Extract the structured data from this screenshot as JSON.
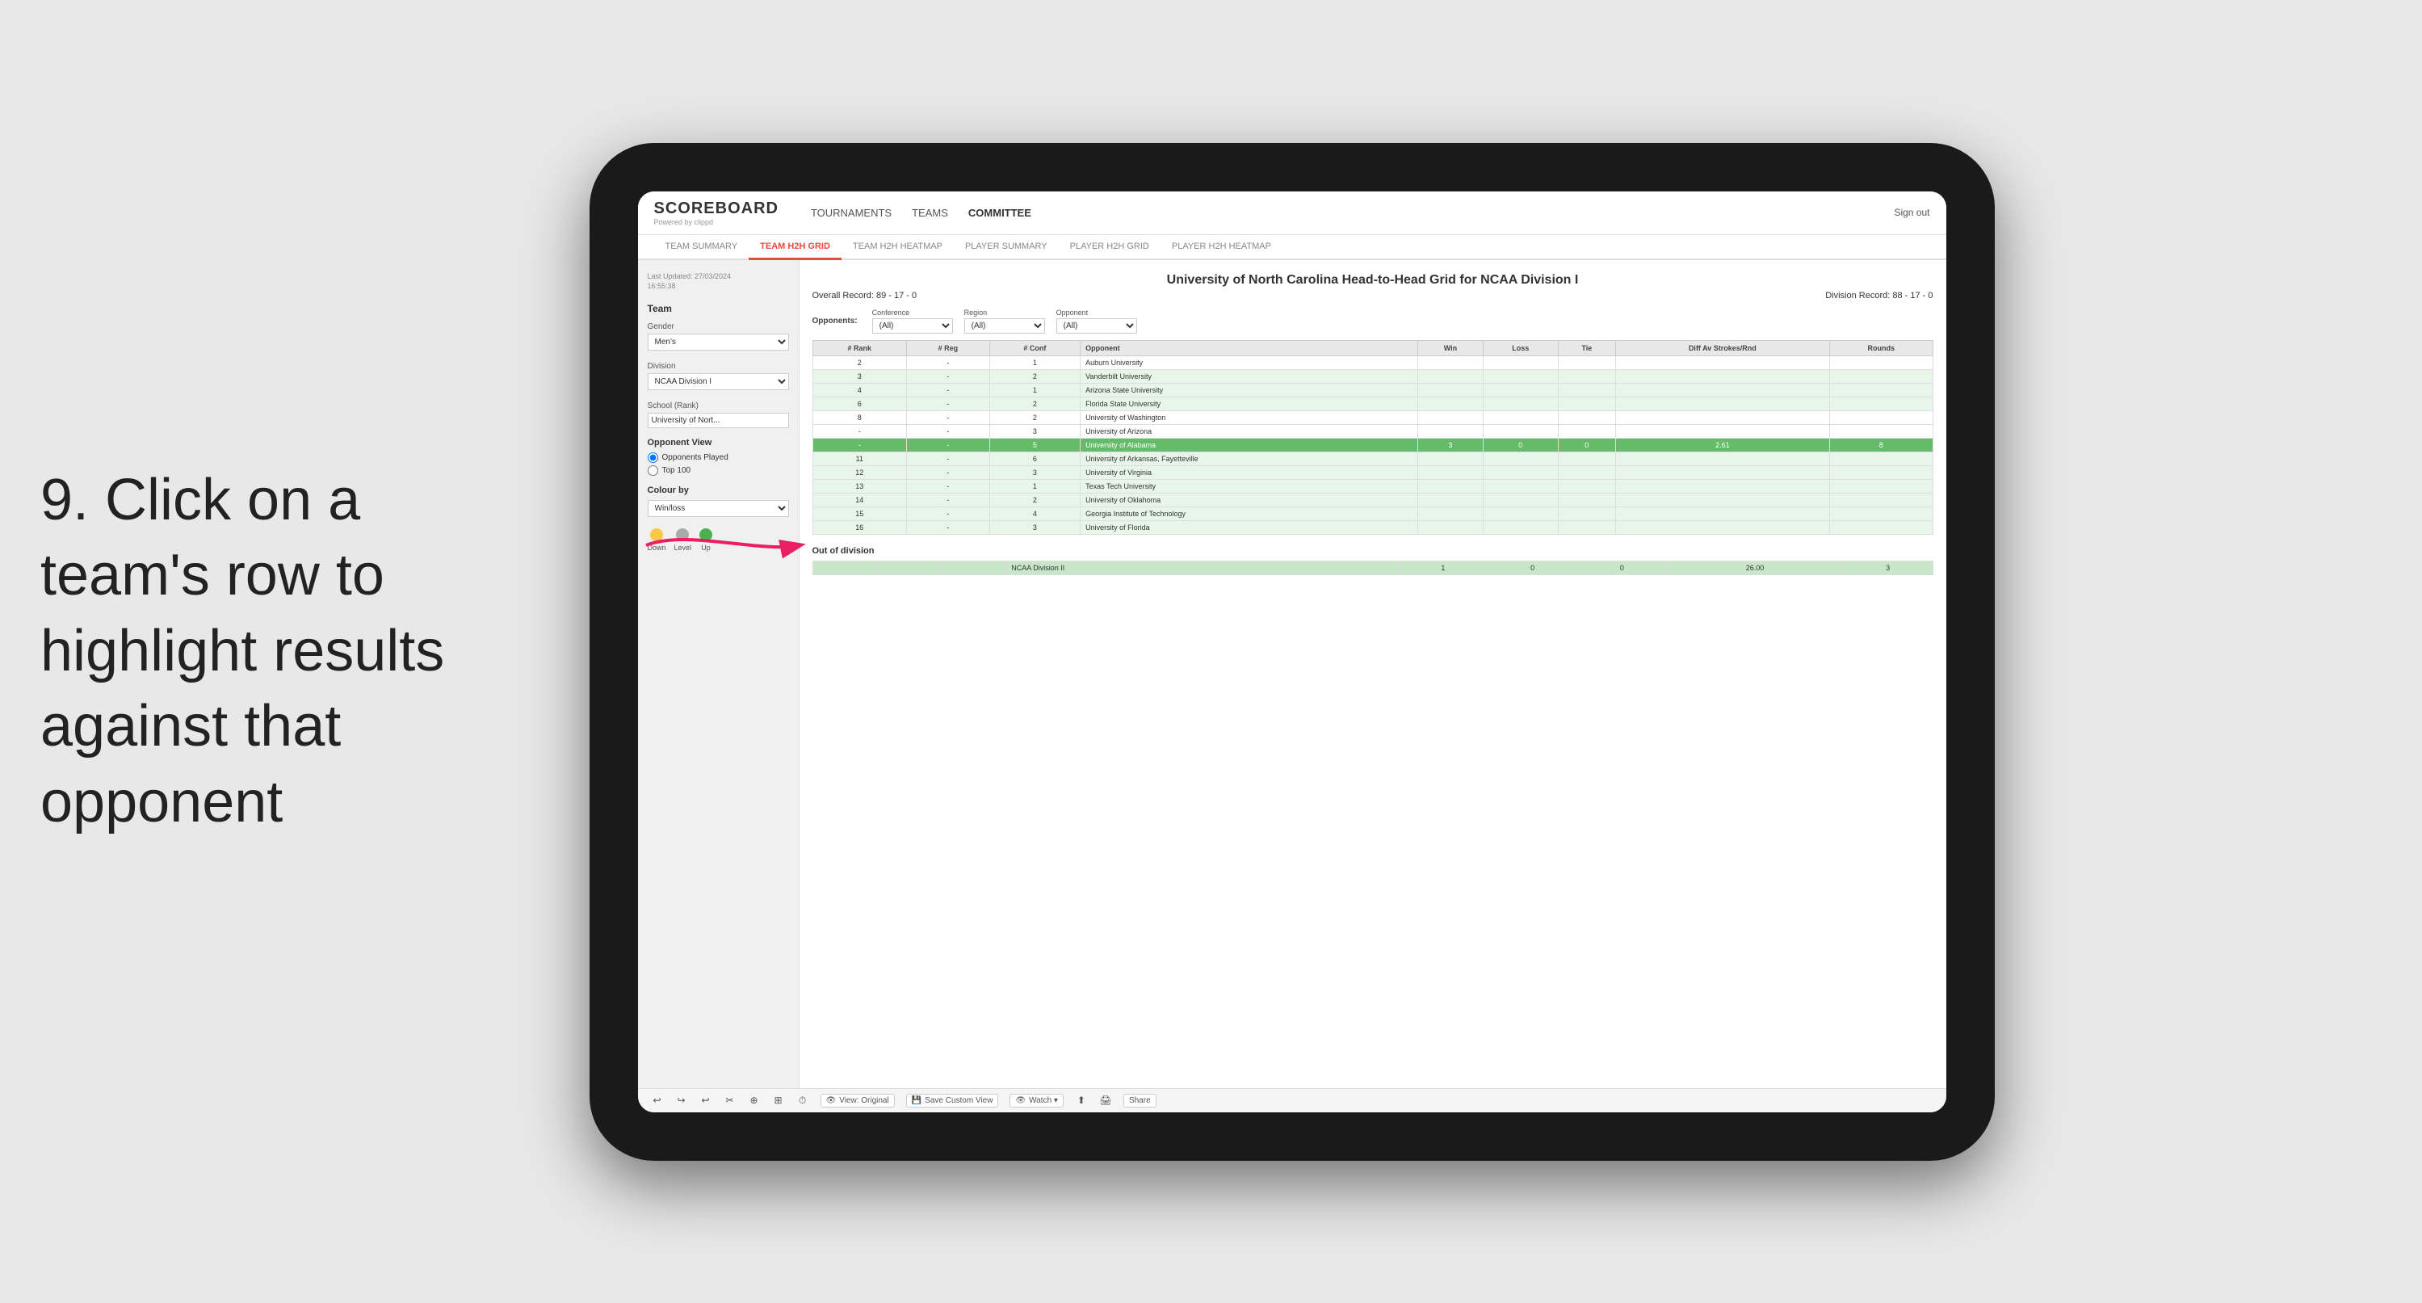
{
  "instruction": {
    "text": "9. Click on a team's row to highlight results against that opponent"
  },
  "nav": {
    "logo": "SCOREBOARD",
    "logo_sub": "Powered by clippd",
    "items": [
      "TOURNAMENTS",
      "TEAMS",
      "COMMITTEE"
    ],
    "sign_out": "Sign out"
  },
  "sub_nav": {
    "items": [
      "TEAM SUMMARY",
      "TEAM H2H GRID",
      "TEAM H2H HEATMAP",
      "PLAYER SUMMARY",
      "PLAYER H2H GRID",
      "PLAYER H2H HEATMAP"
    ],
    "active": "TEAM H2H GRID"
  },
  "sidebar": {
    "last_updated_label": "Last Updated: 27/03/2024",
    "last_updated_time": "16:55:38",
    "team_label": "Team",
    "gender_label": "Gender",
    "gender_value": "Men's",
    "division_label": "Division",
    "division_value": "NCAA Division I",
    "school_label": "School (Rank)",
    "school_value": "University of Nort...",
    "opponent_view_label": "Opponent View",
    "opponents_played": "Opponents Played",
    "top_100": "Top 100",
    "colour_by_label": "Colour by",
    "colour_by_value": "Win/loss",
    "legend_down": "Down",
    "legend_level": "Level",
    "legend_up": "Up"
  },
  "grid": {
    "title": "University of North Carolina Head-to-Head Grid for NCAA Division I",
    "overall_record": "Overall Record: 89 - 17 - 0",
    "division_record": "Division Record: 88 - 17 - 0",
    "filters": {
      "opponents_label": "Opponents:",
      "conference_label": "Conference",
      "conference_value": "(All)",
      "region_label": "Region",
      "region_value": "(All)",
      "opponent_label": "Opponent",
      "opponent_value": "(All)"
    },
    "columns": [
      "# Rank",
      "# Reg",
      "# Conf",
      "Opponent",
      "Win",
      "Loss",
      "Tie",
      "Diff Av Strokes/Rnd",
      "Rounds"
    ],
    "rows": [
      {
        "rank": "2",
        "reg": "-",
        "conf": "1",
        "opponent": "Auburn University",
        "win": "",
        "loss": "",
        "tie": "",
        "diff": "",
        "rounds": "",
        "row_class": "row-normal"
      },
      {
        "rank": "3",
        "reg": "-",
        "conf": "2",
        "opponent": "Vanderbilt University",
        "win": "",
        "loss": "",
        "tie": "",
        "diff": "",
        "rounds": "",
        "row_class": "row-light-green"
      },
      {
        "rank": "4",
        "reg": "-",
        "conf": "1",
        "opponent": "Arizona State University",
        "win": "",
        "loss": "",
        "tie": "",
        "diff": "",
        "rounds": "",
        "row_class": "row-light-green"
      },
      {
        "rank": "6",
        "reg": "-",
        "conf": "2",
        "opponent": "Florida State University",
        "win": "",
        "loss": "",
        "tie": "",
        "diff": "",
        "rounds": "",
        "row_class": "row-light-green"
      },
      {
        "rank": "8",
        "reg": "-",
        "conf": "2",
        "opponent": "University of Washington",
        "win": "",
        "loss": "",
        "tie": "",
        "diff": "",
        "rounds": "",
        "row_class": "row-normal"
      },
      {
        "rank": "-",
        "reg": "-",
        "conf": "3",
        "opponent": "University of Arizona",
        "win": "",
        "loss": "",
        "tie": "",
        "diff": "",
        "rounds": "",
        "row_class": "row-normal"
      },
      {
        "rank": "-",
        "reg": "-",
        "conf": "5",
        "opponent": "University of Alabama",
        "win": "3",
        "loss": "0",
        "tie": "0",
        "diff": "2.61",
        "rounds": "8",
        "row_class": "row-highlighted"
      },
      {
        "rank": "11",
        "reg": "-",
        "conf": "6",
        "opponent": "University of Arkansas, Fayetteville",
        "win": "",
        "loss": "",
        "tie": "",
        "diff": "",
        "rounds": "",
        "row_class": "row-light-green"
      },
      {
        "rank": "12",
        "reg": "-",
        "conf": "3",
        "opponent": "University of Virginia",
        "win": "",
        "loss": "",
        "tie": "",
        "diff": "",
        "rounds": "",
        "row_class": "row-light-green"
      },
      {
        "rank": "13",
        "reg": "-",
        "conf": "1",
        "opponent": "Texas Tech University",
        "win": "",
        "loss": "",
        "tie": "",
        "diff": "",
        "rounds": "",
        "row_class": "row-light-green"
      },
      {
        "rank": "14",
        "reg": "-",
        "conf": "2",
        "opponent": "University of Oklahoma",
        "win": "",
        "loss": "",
        "tie": "",
        "diff": "",
        "rounds": "",
        "row_class": "row-light-green"
      },
      {
        "rank": "15",
        "reg": "-",
        "conf": "4",
        "opponent": "Georgia Institute of Technology",
        "win": "",
        "loss": "",
        "tie": "",
        "diff": "",
        "rounds": "",
        "row_class": "row-light-green"
      },
      {
        "rank": "16",
        "reg": "-",
        "conf": "3",
        "opponent": "University of Florida",
        "win": "",
        "loss": "",
        "tie": "",
        "diff": "",
        "rounds": "",
        "row_class": "row-light-green"
      }
    ],
    "out_of_division_label": "Out of division",
    "out_of_division_row": {
      "label": "NCAA Division II",
      "win": "1",
      "loss": "0",
      "tie": "0",
      "diff": "26.00",
      "rounds": "3"
    }
  },
  "toolbar": {
    "undo": "↩",
    "redo": "↪",
    "view_original": "View: Original",
    "save_custom": "Save Custom View",
    "watch": "Watch ▾",
    "share": "Share"
  }
}
